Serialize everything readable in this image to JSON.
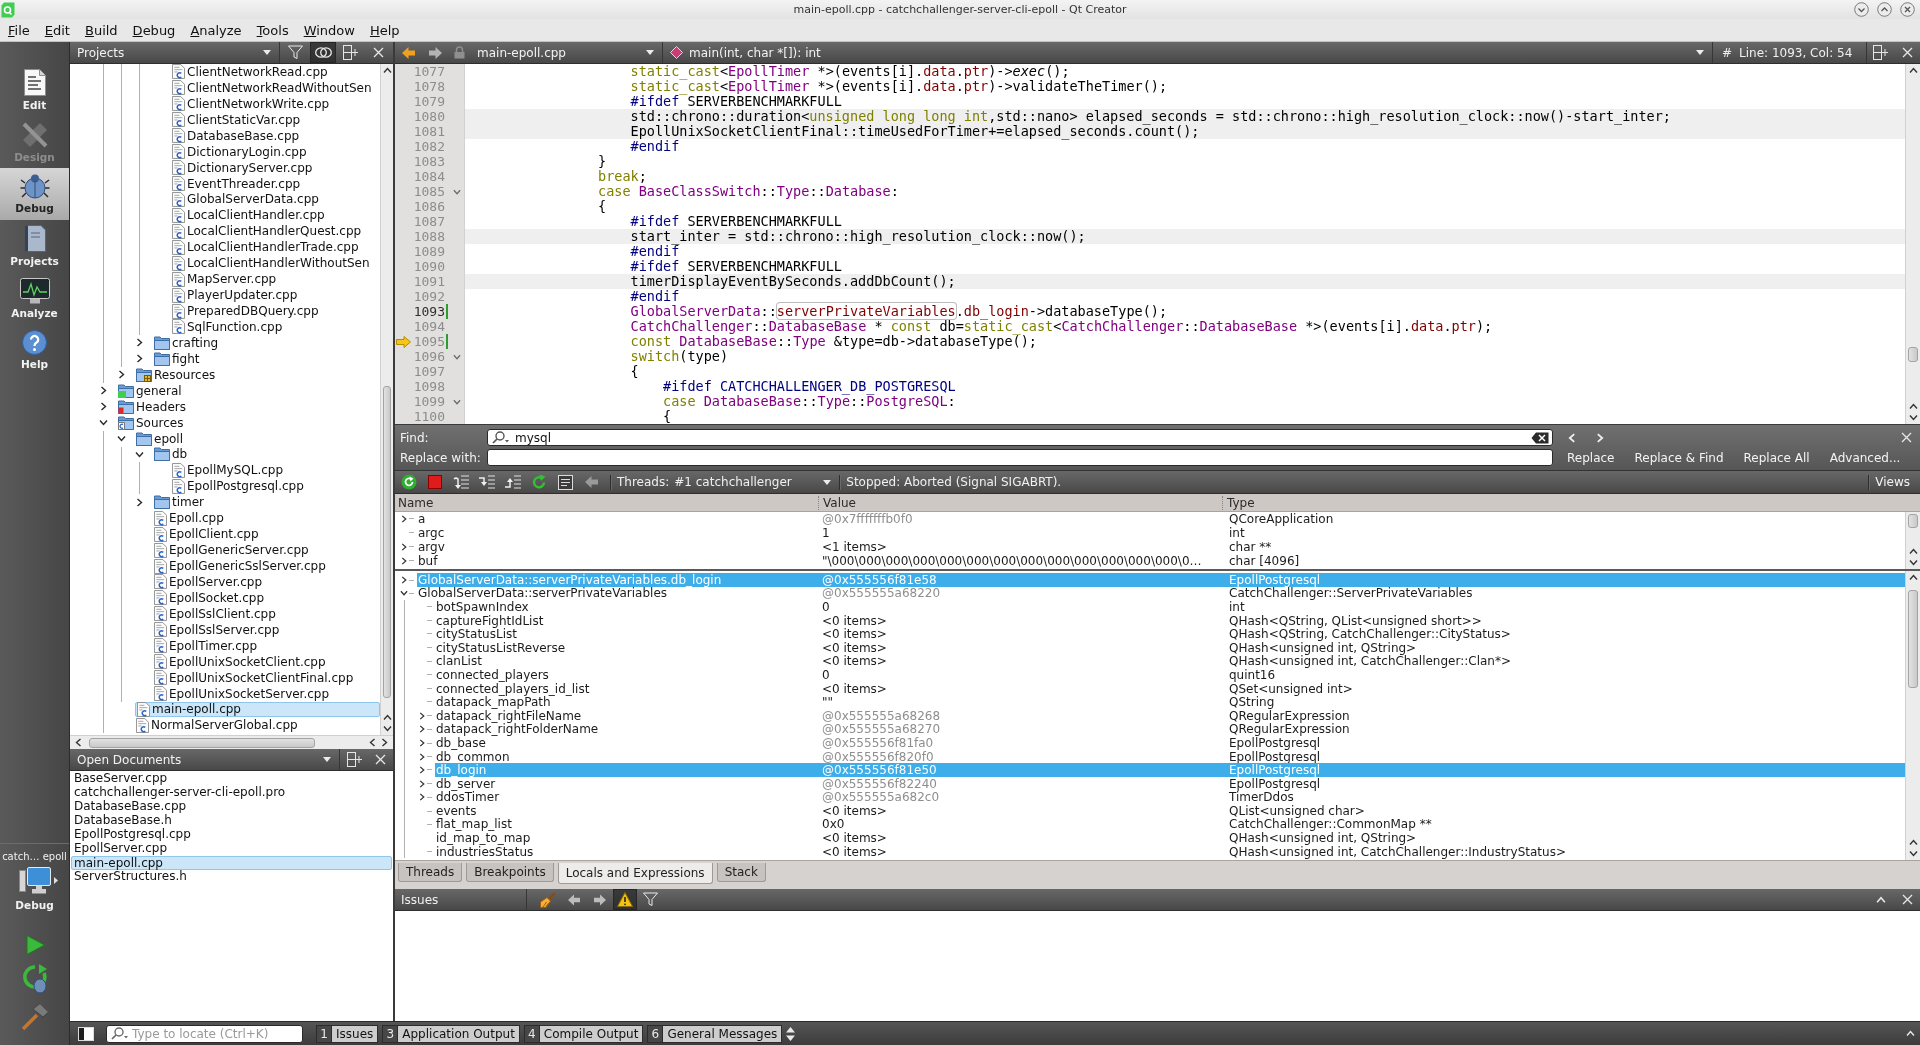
{
  "window": {
    "title": "main-epoll.cpp - catchchallenger-server-cli-epoll - Qt Creator"
  },
  "menu": [
    "File",
    "Edit",
    "Build",
    "Debug",
    "Analyze",
    "Tools",
    "Window",
    "Help"
  ],
  "modes": [
    {
      "kind": "edit",
      "label": "Edit",
      "selected": false,
      "disabled": false
    },
    {
      "kind": "design",
      "label": "Design",
      "selected": false,
      "disabled": true
    },
    {
      "kind": "debug",
      "label": "Debug",
      "selected": true,
      "disabled": false
    },
    {
      "kind": "projects",
      "label": "Projects",
      "selected": false,
      "disabled": false
    },
    {
      "kind": "analyze",
      "label": "Analyze",
      "selected": false,
      "disabled": false
    },
    {
      "kind": "help",
      "label": "Help",
      "selected": false,
      "disabled": false
    }
  ],
  "kit": {
    "project": "catch… epoll",
    "build": "Debug"
  },
  "projects": {
    "title": "Projects",
    "sync_with_editor": true,
    "tree": [
      {
        "children": [
          {
            "children": [
              {
                "children": [
                  {
                    "label": "ClientNetworkRead.cpp",
                    "kind": "cpp",
                    "selected": false
                  },
                  {
                    "label": "ClientNetworkReadWithoutSen",
                    "kind": "cpp",
                    "selected": false
                  },
                  {
                    "label": "ClientNetworkWrite.cpp",
                    "kind": "cpp",
                    "selected": false
                  },
                  {
                    "label": "ClientStaticVar.cpp",
                    "kind": "cpp",
                    "selected": false
                  },
                  {
                    "label": "DatabaseBase.cpp",
                    "kind": "cpp",
                    "selected": false
                  },
                  {
                    "label": "DictionaryLogin.cpp",
                    "kind": "cpp",
                    "selected": false
                  },
                  {
                    "label": "DictionaryServer.cpp",
                    "kind": "cpp",
                    "selected": false
                  },
                  {
                    "label": "EventThreader.cpp",
                    "kind": "cpp",
                    "selected": false
                  },
                  {
                    "label": "GlobalServerData.cpp",
                    "kind": "cpp",
                    "selected": false
                  },
                  {
                    "label": "LocalClientHandler.cpp",
                    "kind": "cpp",
                    "selected": false
                  },
                  {
                    "label": "LocalClientHandlerQuest.cpp",
                    "kind": "cpp",
                    "selected": false
                  },
                  {
                    "label": "LocalClientHandlerTrade.cpp",
                    "kind": "cpp",
                    "selected": false
                  },
                  {
                    "label": "LocalClientHandlerWithoutSen",
                    "kind": "cpp",
                    "selected": false
                  },
                  {
                    "label": "MapServer.cpp",
                    "kind": "cpp",
                    "selected": false
                  },
                  {
                    "label": "PlayerUpdater.cpp",
                    "kind": "cpp",
                    "selected": false
                  },
                  {
                    "label": "PreparedDBQuery.cpp",
                    "kind": "cpp",
                    "selected": false
                  },
                  {
                    "label": "SqlFunction.cpp",
                    "kind": "cpp",
                    "selected": false
                  }
                ]
              },
              {
                "label": "crafting",
                "kind": "folder",
                "expanded": false,
                "selected": false
              },
              {
                "label": "fight",
                "kind": "folder",
                "expanded": false,
                "selected": false
              }
            ]
          },
          {
            "label": "Resources",
            "kind": "resources",
            "expanded": false,
            "selected": false
          }
        ]
      },
      {
        "label": "general",
        "kind": "qt-folder",
        "expanded": false,
        "selected": false
      },
      {
        "label": "Headers",
        "kind": "headers",
        "expanded": false,
        "selected": false
      },
      {
        "label": "Sources",
        "kind": "sources",
        "expanded": true,
        "selected": false,
        "children": [
          {
            "label": "epoll",
            "kind": "folder",
            "expanded": true,
            "selected": false,
            "children": [
              {
                "label": "db",
                "kind": "folder",
                "expanded": true,
                "selected": false,
                "children": [
                  {
                    "label": "EpollMySQL.cpp",
                    "kind": "cpp",
                    "selected": false
                  },
                  {
                    "label": "EpollPostgresql.cpp",
                    "kind": "cpp",
                    "selected": false
                  }
                ]
              },
              {
                "label": "timer",
                "kind": "folder",
                "expanded": false,
                "selected": false
              },
              {
                "label": "Epoll.cpp",
                "kind": "cpp",
                "selected": false
              },
              {
                "label": "EpollClient.cpp",
                "kind": "cpp",
                "selected": false
              },
              {
                "label": "EpollGenericServer.cpp",
                "kind": "cpp",
                "selected": false
              },
              {
                "label": "EpollGenericSslServer.cpp",
                "kind": "cpp",
                "selected": false
              },
              {
                "label": "EpollServer.cpp",
                "kind": "cpp",
                "selected": false
              },
              {
                "label": "EpollSocket.cpp",
                "kind": "cpp",
                "selected": false
              },
              {
                "label": "EpollSslClient.cpp",
                "kind": "cpp",
                "selected": false
              },
              {
                "label": "EpollSslServer.cpp",
                "kind": "cpp",
                "selected": false
              },
              {
                "label": "EpollTimer.cpp",
                "kind": "cpp",
                "selected": false
              },
              {
                "label": "EpollUnixSocketClient.cpp",
                "kind": "cpp",
                "selected": false
              },
              {
                "label": "EpollUnixSocketClientFinal.cpp",
                "kind": "cpp",
                "selected": false
              },
              {
                "label": "EpollUnixSocketServer.cpp",
                "kind": "cpp",
                "selected": false
              }
            ]
          },
          {
            "label": "main-epoll.cpp",
            "kind": "cpp",
            "selected": true
          },
          {
            "label": "NormalServerGlobal.cpp",
            "kind": "cpp",
            "selected": false
          }
        ]
      }
    ]
  },
  "open_documents": {
    "title": "Open Documents",
    "items": [
      {
        "label": "BaseServer.cpp",
        "selected": false
      },
      {
        "label": "catchchallenger-server-cli-epoll.pro",
        "selected": false
      },
      {
        "label": "DatabaseBase.cpp",
        "selected": false
      },
      {
        "label": "DatabaseBase.h",
        "selected": false
      },
      {
        "label": "EpollPostgresql.cpp",
        "selected": false
      },
      {
        "label": "EpollServer.cpp",
        "selected": false
      },
      {
        "label": "main-epoll.cpp",
        "selected": true
      },
      {
        "label": "ServerStructures.h",
        "selected": false
      }
    ]
  },
  "editor": {
    "file": "main-epoll.cpp",
    "symbol": "main(int, char *[]): int",
    "position_marker": "#",
    "position": "Line: 1093, Col: 54",
    "lines": [
      {
        "number": "1077",
        "current": false,
        "arrow": false,
        "changed": false,
        "foldable": false,
        "inactive": false,
        "segments": [
          {
            "kind": "keyword",
            "text": "                    static_cast"
          },
          {
            "kind": "plain",
            "text": "<"
          },
          {
            "kind": "type",
            "text": "EpollTimer"
          },
          {
            "kind": "plain",
            "text": " *>(events[i]."
          },
          {
            "kind": "field",
            "text": "data"
          },
          {
            "kind": "plain",
            "text": "."
          },
          {
            "kind": "field",
            "text": "ptr"
          },
          {
            "kind": "plain",
            "text": ")->"
          },
          {
            "kind": "virtual",
            "text": "exec"
          },
          {
            "kind": "plain",
            "text": "();"
          }
        ]
      },
      {
        "number": "1078",
        "current": false,
        "arrow": false,
        "changed": false,
        "foldable": false,
        "inactive": false,
        "segments": [
          {
            "kind": "keyword",
            "text": "                    static_cast"
          },
          {
            "kind": "plain",
            "text": "<"
          },
          {
            "kind": "type",
            "text": "EpollTimer"
          },
          {
            "kind": "plain",
            "text": " *>(events[i]."
          },
          {
            "kind": "field",
            "text": "data"
          },
          {
            "kind": "plain",
            "text": "."
          },
          {
            "kind": "field",
            "text": "ptr"
          },
          {
            "kind": "plain",
            "text": ")->validateTheTimer();"
          }
        ]
      },
      {
        "number": "1079",
        "current": false,
        "arrow": false,
        "changed": false,
        "foldable": false,
        "inactive": false,
        "segments": [
          {
            "kind": "preproc",
            "text": "                    #ifdef"
          },
          {
            "kind": "plain",
            "text": " SERVERBENCHMARKFULL"
          }
        ]
      },
      {
        "number": "1080",
        "current": false,
        "arrow": false,
        "changed": false,
        "foldable": false,
        "inactive": true,
        "segments": [
          {
            "kind": "plain",
            "text": "                    std::chrono::duration<"
          },
          {
            "kind": "keyword",
            "text": "unsigned long long int"
          },
          {
            "kind": "plain",
            "text": ",std::nano> elapsed_seconds = std::chrono::high_resolution_clock::now()-start_inter;"
          }
        ]
      },
      {
        "number": "1081",
        "current": false,
        "arrow": false,
        "changed": false,
        "foldable": false,
        "inactive": true,
        "segments": [
          {
            "kind": "plain",
            "text": "                    EpollUnixSocketClientFinal::timeUsedForTimer+=elapsed_seconds.count();"
          }
        ]
      },
      {
        "number": "1082",
        "current": false,
        "arrow": false,
        "changed": false,
        "foldable": false,
        "inactive": false,
        "segments": [
          {
            "kind": "preproc",
            "text": "                    #endif"
          }
        ]
      },
      {
        "number": "1083",
        "current": false,
        "arrow": false,
        "changed": false,
        "foldable": false,
        "inactive": false,
        "segments": [
          {
            "kind": "plain",
            "text": "                }"
          }
        ]
      },
      {
        "number": "1084",
        "current": false,
        "arrow": false,
        "changed": false,
        "foldable": false,
        "inactive": false,
        "segments": [
          {
            "kind": "keyword",
            "text": "                break"
          },
          {
            "kind": "plain",
            "text": ";"
          }
        ]
      },
      {
        "number": "1085",
        "current": false,
        "arrow": false,
        "changed": false,
        "foldable": true,
        "inactive": false,
        "segments": [
          {
            "kind": "keyword",
            "text": "                case "
          },
          {
            "kind": "type",
            "text": "BaseClassSwitch"
          },
          {
            "kind": "plain",
            "text": "::"
          },
          {
            "kind": "type",
            "text": "Type"
          },
          {
            "kind": "plain",
            "text": "::"
          },
          {
            "kind": "type",
            "text": "Database"
          },
          {
            "kind": "plain",
            "text": ":"
          }
        ]
      },
      {
        "number": "1086",
        "current": false,
        "arrow": false,
        "changed": false,
        "foldable": false,
        "inactive": false,
        "segments": [
          {
            "kind": "plain",
            "text": "                {"
          }
        ]
      },
      {
        "number": "1087",
        "current": false,
        "arrow": false,
        "changed": false,
        "foldable": false,
        "inactive": false,
        "segments": [
          {
            "kind": "preproc",
            "text": "                    #ifdef"
          },
          {
            "kind": "plain",
            "text": " SERVERBENCHMARKFULL"
          }
        ]
      },
      {
        "number": "1088",
        "current": false,
        "arrow": false,
        "changed": false,
        "foldable": false,
        "inactive": true,
        "segments": [
          {
            "kind": "plain",
            "text": "                    start_inter = std::chrono::high_resolution_clock::now();"
          }
        ]
      },
      {
        "number": "1089",
        "current": false,
        "arrow": false,
        "changed": false,
        "foldable": false,
        "inactive": false,
        "segments": [
          {
            "kind": "preproc",
            "text": "                    #endif"
          }
        ]
      },
      {
        "number": "1090",
        "current": false,
        "arrow": false,
        "changed": false,
        "foldable": false,
        "inactive": false,
        "segments": [
          {
            "kind": "preproc",
            "text": "                    #ifdef"
          },
          {
            "kind": "plain",
            "text": " SERVERBENCHMARKFULL"
          }
        ]
      },
      {
        "number": "1091",
        "current": false,
        "arrow": false,
        "changed": false,
        "foldable": false,
        "inactive": true,
        "segments": [
          {
            "kind": "plain",
            "text": "                    timerDisplayEventBySeconds.addDbCount();"
          }
        ]
      },
      {
        "number": "1092",
        "current": false,
        "arrow": false,
        "changed": false,
        "foldable": false,
        "inactive": false,
        "segments": [
          {
            "kind": "preproc",
            "text": "                    #endif"
          }
        ]
      },
      {
        "number": "1093",
        "current": true,
        "arrow": false,
        "changed": true,
        "foldable": false,
        "inactive": false,
        "segments": [
          {
            "kind": "type",
            "text": "                    GlobalServerData"
          },
          {
            "kind": "plain",
            "text": "::"
          },
          {
            "kind": "occurrence",
            "text": "serverPrivateVariables"
          },
          {
            "kind": "plain",
            "text": "."
          },
          {
            "kind": "field",
            "text": "db_login"
          },
          {
            "kind": "plain",
            "text": "->databaseType();"
          }
        ]
      },
      {
        "number": "1094",
        "current": false,
        "arrow": false,
        "changed": false,
        "foldable": false,
        "inactive": false,
        "segments": [
          {
            "kind": "type",
            "text": "                    CatchChallenger"
          },
          {
            "kind": "plain",
            "text": "::"
          },
          {
            "kind": "type",
            "text": "DatabaseBase"
          },
          {
            "kind": "plain",
            "text": " * "
          },
          {
            "kind": "keyword",
            "text": "const"
          },
          {
            "kind": "plain",
            "text": " db="
          },
          {
            "kind": "keyword",
            "text": "static_cast"
          },
          {
            "kind": "plain",
            "text": "<"
          },
          {
            "kind": "type",
            "text": "CatchChallenger"
          },
          {
            "kind": "plain",
            "text": "::"
          },
          {
            "kind": "type",
            "text": "DatabaseBase"
          },
          {
            "kind": "plain",
            "text": " *>(events[i]."
          },
          {
            "kind": "field",
            "text": "data"
          },
          {
            "kind": "plain",
            "text": "."
          },
          {
            "kind": "field",
            "text": "ptr"
          },
          {
            "kind": "plain",
            "text": ");"
          }
        ]
      },
      {
        "number": "1095",
        "current": false,
        "arrow": true,
        "changed": true,
        "foldable": false,
        "inactive": false,
        "segments": [
          {
            "kind": "keyword",
            "text": "                    const "
          },
          {
            "kind": "type",
            "text": "DatabaseBase"
          },
          {
            "kind": "plain",
            "text": "::"
          },
          {
            "kind": "type",
            "text": "Type"
          },
          {
            "kind": "plain",
            "text": " &type=db->databaseType();"
          }
        ]
      },
      {
        "number": "1096",
        "current": false,
        "arrow": false,
        "changed": false,
        "foldable": true,
        "inactive": false,
        "segments": [
          {
            "kind": "keyword",
            "text": "                    switch"
          },
          {
            "kind": "plain",
            "text": "(type)"
          }
        ]
      },
      {
        "number": "1097",
        "current": false,
        "arrow": false,
        "changed": false,
        "foldable": false,
        "inactive": false,
        "segments": [
          {
            "kind": "plain",
            "text": "                    {"
          }
        ]
      },
      {
        "number": "1098",
        "current": false,
        "arrow": false,
        "changed": false,
        "foldable": false,
        "inactive": false,
        "segments": [
          {
            "kind": "preproc",
            "text": "                        #ifdef CATCHCHALLENGER_DB_POSTGRESQL"
          }
        ]
      },
      {
        "number": "1099",
        "current": false,
        "arrow": false,
        "changed": false,
        "foldable": true,
        "inactive": false,
        "segments": [
          {
            "kind": "keyword",
            "text": "                        case "
          },
          {
            "kind": "type",
            "text": "DatabaseBase"
          },
          {
            "kind": "plain",
            "text": "::"
          },
          {
            "kind": "type",
            "text": "Type"
          },
          {
            "kind": "plain",
            "text": "::"
          },
          {
            "kind": "type",
            "text": "PostgreSQL"
          },
          {
            "kind": "plain",
            "text": ":"
          }
        ]
      },
      {
        "number": "1100",
        "current": false,
        "arrow": false,
        "changed": false,
        "foldable": false,
        "inactive": false,
        "segments": [
          {
            "kind": "plain",
            "text": "                        {"
          }
        ]
      }
    ]
  },
  "find": {
    "label": "Find:",
    "value": "mysql",
    "replace_label": "Replace with:",
    "buttons": [
      "Replace",
      "Replace & Find",
      "Replace All",
      "Advanced..."
    ]
  },
  "debugger": {
    "threads_label": "Threads:",
    "thread": "#1 catchchallenger",
    "status": "Stopped: Aborted (Signal SIGABRT).",
    "views": "Views"
  },
  "locals": {
    "columns": [
      "Name",
      "Value",
      "Type"
    ],
    "rows": [
      {
        "name": "a",
        "value": "@0x7fffffffb0f0",
        "type": "QCoreApplication",
        "expanded": false,
        "greyed": true,
        "selected": false
      },
      {
        "name": "argc",
        "value": "1",
        "type": "int",
        "greyed": false,
        "selected": false
      },
      {
        "name": "argv",
        "value": "<1 items>",
        "type": "char **",
        "expanded": false,
        "greyed": false,
        "selected": false
      },
      {
        "name": "buf",
        "value": "\"\\000\\000\\000\\000\\000\\000\\000\\000\\000\\000\\000\\000\\000\\0…",
        "type": "char [4096]",
        "expanded": false,
        "greyed": false,
        "selected": false
      }
    ],
    "expressions": [
      {
        "name": "GlobalServerData::serverPrivateVariables.db_login",
        "value": "@0x555556f81e58",
        "type": "EpollPostgresql",
        "expanded": false,
        "greyed": true,
        "selected": true
      },
      {
        "name": "GlobalServerData::serverPrivateVariables",
        "value": "@0x555555a68220",
        "type": "CatchChallenger::ServerPrivateVariables",
        "expanded": true,
        "greyed": true,
        "selected": false,
        "children": [
          {
            "name": "botSpawnIndex",
            "value": "0",
            "type": "int",
            "greyed": false,
            "selected": false
          },
          {
            "name": "captureFightIdList",
            "value": "<0 items>",
            "type": "QHash<QString, QList<unsigned short>>",
            "greyed": false,
            "selected": false
          },
          {
            "name": "cityStatusList",
            "value": "<0 items>",
            "type": "QHash<QString, CatchChallenger::CityStatus>",
            "greyed": false,
            "selected": false
          },
          {
            "name": "cityStatusListReverse",
            "value": "<0 items>",
            "type": "QHash<unsigned int, QString>",
            "greyed": false,
            "selected": false
          },
          {
            "name": "clanList",
            "value": "<0 items>",
            "type": "QHash<unsigned int, CatchChallenger::Clan*>",
            "greyed": false,
            "selected": false
          },
          {
            "name": "connected_players",
            "value": "0",
            "type": "quint16",
            "greyed": false,
            "selected": false
          },
          {
            "name": "connected_players_id_list",
            "value": "<0 items>",
            "type": "QSet<unsigned int>",
            "greyed": false,
            "selected": false
          },
          {
            "name": "datapack_mapPath",
            "value": "\"\"",
            "type": "QString",
            "greyed": false,
            "selected": false
          },
          {
            "name": "datapack_rightFileName",
            "value": "@0x555555a68268",
            "type": "QRegularExpression",
            "expanded": false,
            "greyed": true,
            "selected": false
          },
          {
            "name": "datapack_rightFolderName",
            "value": "@0x555555a68270",
            "type": "QRegularExpression",
            "expanded": false,
            "greyed": true,
            "selected": false
          },
          {
            "name": "db_base",
            "value": "@0x555556f81fa0",
            "type": "EpollPostgresql",
            "expanded": false,
            "greyed": true,
            "selected": false
          },
          {
            "name": "db_common",
            "value": "@0x555556f820f0",
            "type": "EpollPostgresql",
            "expanded": false,
            "greyed": true,
            "selected": false
          },
          {
            "name": "db_login",
            "value": "@0x555556f81e50",
            "type": "EpollPostgresql",
            "expanded": false,
            "greyed": true,
            "selected": true
          },
          {
            "name": "db_server",
            "value": "@0x555556f82240",
            "type": "EpollPostgresql",
            "expanded": false,
            "greyed": true,
            "selected": false
          },
          {
            "name": "ddosTimer",
            "value": "@0x555555a682c0",
            "type": "TimerDdos",
            "expanded": false,
            "greyed": true,
            "selected": false
          },
          {
            "name": "events",
            "value": "<0 items>",
            "type": "QList<unsigned char>",
            "greyed": false,
            "selected": false
          },
          {
            "name": "flat_map_list",
            "value": "0x0",
            "type": "CatchChallenger::CommonMap **",
            "greyed": false,
            "selected": false
          },
          {
            "name": "id_map_to_map",
            "value": "<0 items>",
            "type": "QHash<unsigned int, QString>",
            "greyed": false,
            "selected": false
          },
          {
            "name": "industriesStatus",
            "value": "<0 items>",
            "type": "QHash<unsigned int, CatchChallenger::IndustryStatus>",
            "greyed": false,
            "selected": false
          }
        ]
      }
    ]
  },
  "debug_tabs": [
    {
      "label": "Threads",
      "selected": false
    },
    {
      "label": "Breakpoints",
      "selected": false
    },
    {
      "label": "Locals and Expressions",
      "selected": true
    },
    {
      "label": "Stack",
      "selected": false
    }
  ],
  "issues": {
    "title": "Issues",
    "warnings_filter_on": true
  },
  "status_bar": {
    "locator": {
      "placeholder": "Type to locate (Ctrl+K)"
    },
    "panes": [
      {
        "number": "1",
        "label": "Issues"
      },
      {
        "number": "3",
        "label": "Application Output"
      },
      {
        "number": "4",
        "label": "Compile Output"
      },
      {
        "number": "6",
        "label": "General Messages"
      }
    ]
  }
}
